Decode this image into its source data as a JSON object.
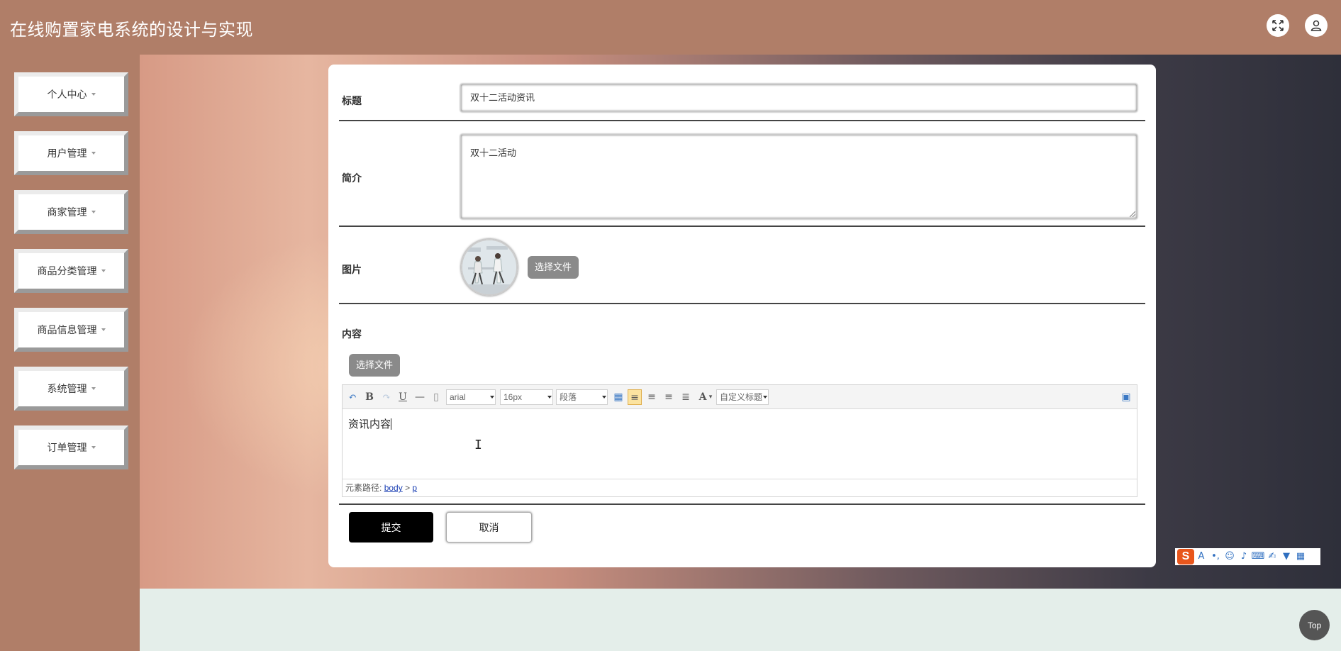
{
  "header": {
    "title": "在线购置家电系统的设计与实现",
    "fullscreen_icon": "fullscreen-icon",
    "user_icon": "user-icon"
  },
  "sidebar": {
    "items": [
      {
        "label": "个人中心"
      },
      {
        "label": "用户管理"
      },
      {
        "label": "商家管理"
      },
      {
        "label": "商品分类管理"
      },
      {
        "label": "商品信息管理"
      },
      {
        "label": "系统管理"
      },
      {
        "label": "订单管理"
      }
    ]
  },
  "form": {
    "title_label": "标题",
    "title_value": "双十二活动资讯",
    "intro_label": "简介",
    "intro_value": "双十二活动",
    "image_label": "图片",
    "image_file_button": "选择文件",
    "content_label": "内容",
    "content_file_button": "选择文件",
    "submit_label": "提交",
    "cancel_label": "取消"
  },
  "editor": {
    "font_family": "arial",
    "font_size": "16px",
    "paragraph": "段落",
    "custom_heading": "自定义标题",
    "content": "资讯内容",
    "path_label": "元素路径:",
    "path_body": "body",
    "path_sep": ">",
    "path_p": "p"
  },
  "ime": {
    "logo": "S"
  },
  "top_button": "Top"
}
